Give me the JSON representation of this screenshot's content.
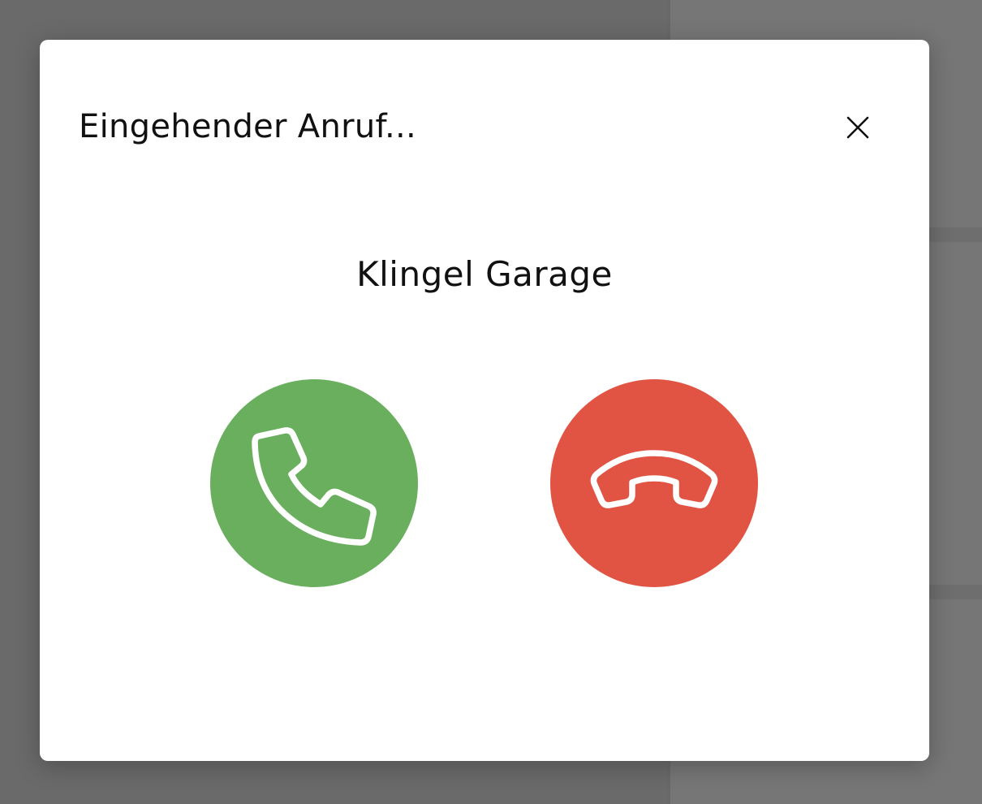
{
  "dialog": {
    "title": "Eingehender Anruf...",
    "caller_name": "Klingel Garage",
    "close_icon": "close-icon",
    "accept": {
      "icon": "phone-accept-icon",
      "color": "#6aaf5e"
    },
    "decline": {
      "icon": "phone-hangup-icon",
      "color": "#e15443"
    }
  },
  "colors": {
    "overlay": "#6a6a6a",
    "dialog_background": "#ffffff",
    "text": "#111111"
  }
}
